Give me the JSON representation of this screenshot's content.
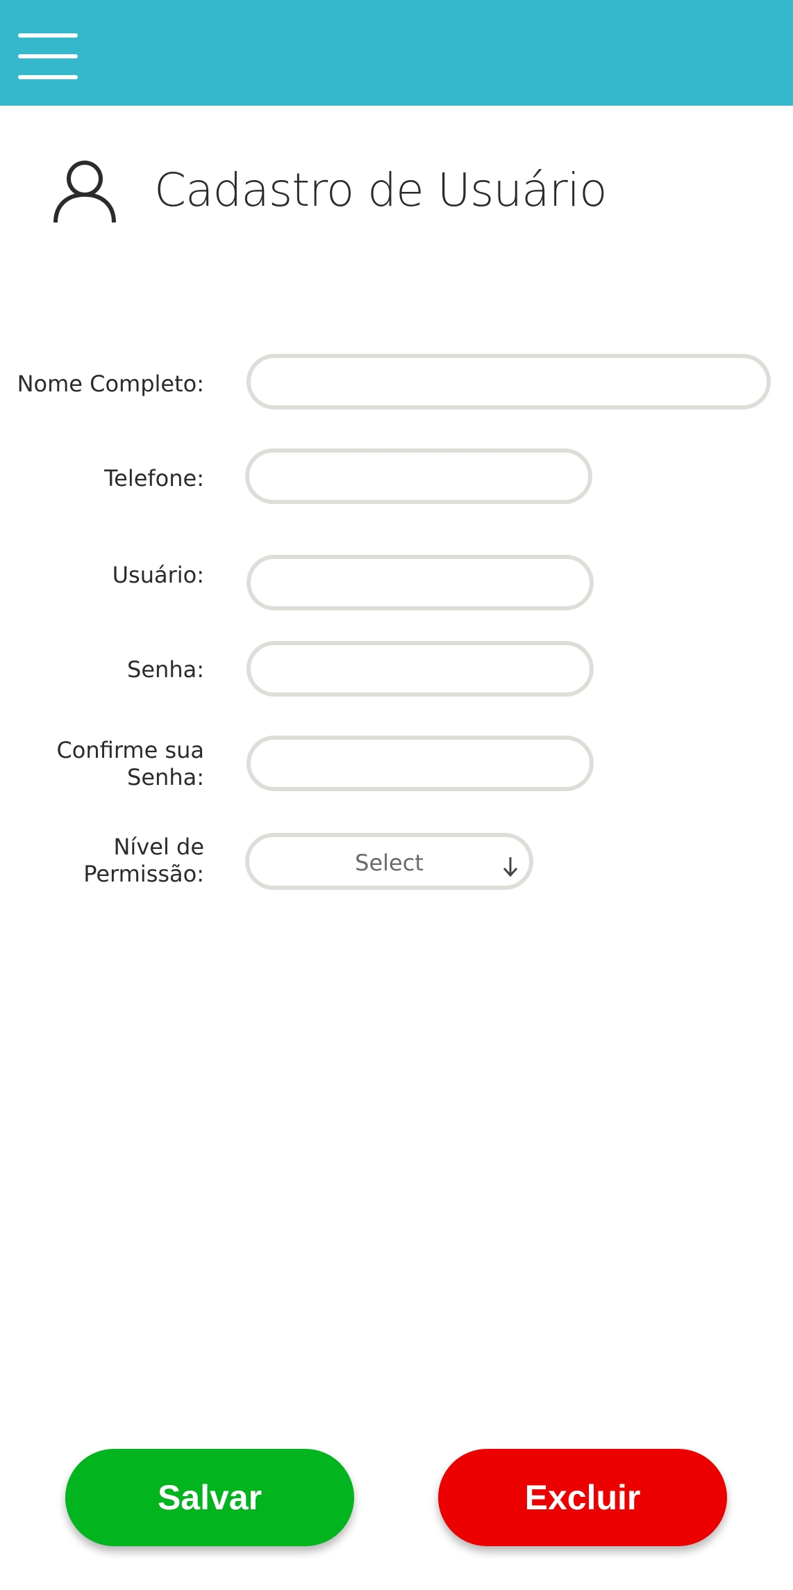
{
  "header": {
    "menu_icon": "hamburger-menu-icon",
    "color": "#36b8cc"
  },
  "page": {
    "icon": "user-icon",
    "title": "Cadastro de Usuário"
  },
  "form": {
    "full_name": {
      "label": "Nome Completo:",
      "value": ""
    },
    "phone": {
      "label": "Telefone:",
      "value": ""
    },
    "username": {
      "label": "Usuário:",
      "value": ""
    },
    "password": {
      "label": "Senha:",
      "value": ""
    },
    "confirm_password": {
      "label_line1": "Confirme sua",
      "label_line2": "Senha:",
      "value": ""
    },
    "permission": {
      "label_line1": "Nível de",
      "label_line2": "Permissão:",
      "selected": "Select",
      "icon": "arrow-down-icon"
    }
  },
  "actions": {
    "save_label": "Salvar",
    "save_color": "#02b41e",
    "delete_label": "Excluir",
    "delete_color": "#ec0000"
  }
}
